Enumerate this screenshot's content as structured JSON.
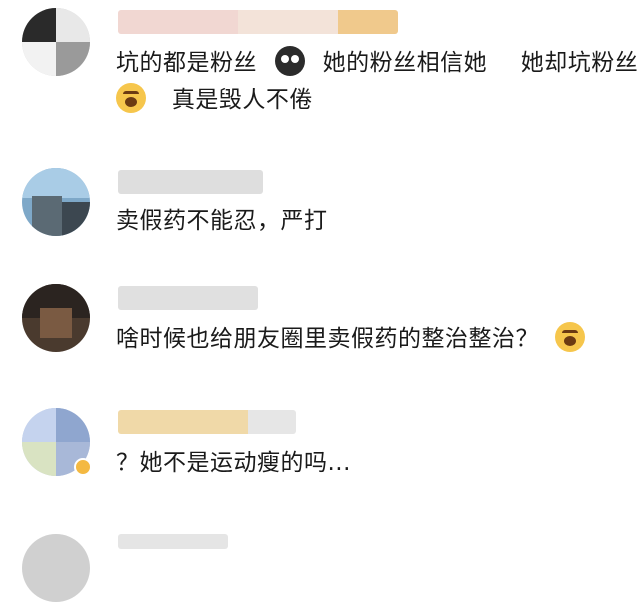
{
  "comments": [
    {
      "lines": [
        "坑的都是粉丝",
        "她的粉丝相信她",
        "她却坑粉丝",
        "真是毁人不倦"
      ]
    },
    {
      "lines": [
        "卖假药不能忍，严打"
      ]
    },
    {
      "lines": [
        "啥时候也给朋友圈里卖假药的整治整治？"
      ]
    },
    {
      "lines": [
        "？她不是运动瘦的吗..."
      ]
    }
  ],
  "icons": {
    "emoji_1": "crying-face-icon",
    "emoji_2": "angry-face-icon",
    "emoji_3": "surprised-face-icon"
  },
  "colors": {
    "background": "#ffffff",
    "text": "#1a1a1a",
    "emoji_yellow": "#f6c64c"
  }
}
